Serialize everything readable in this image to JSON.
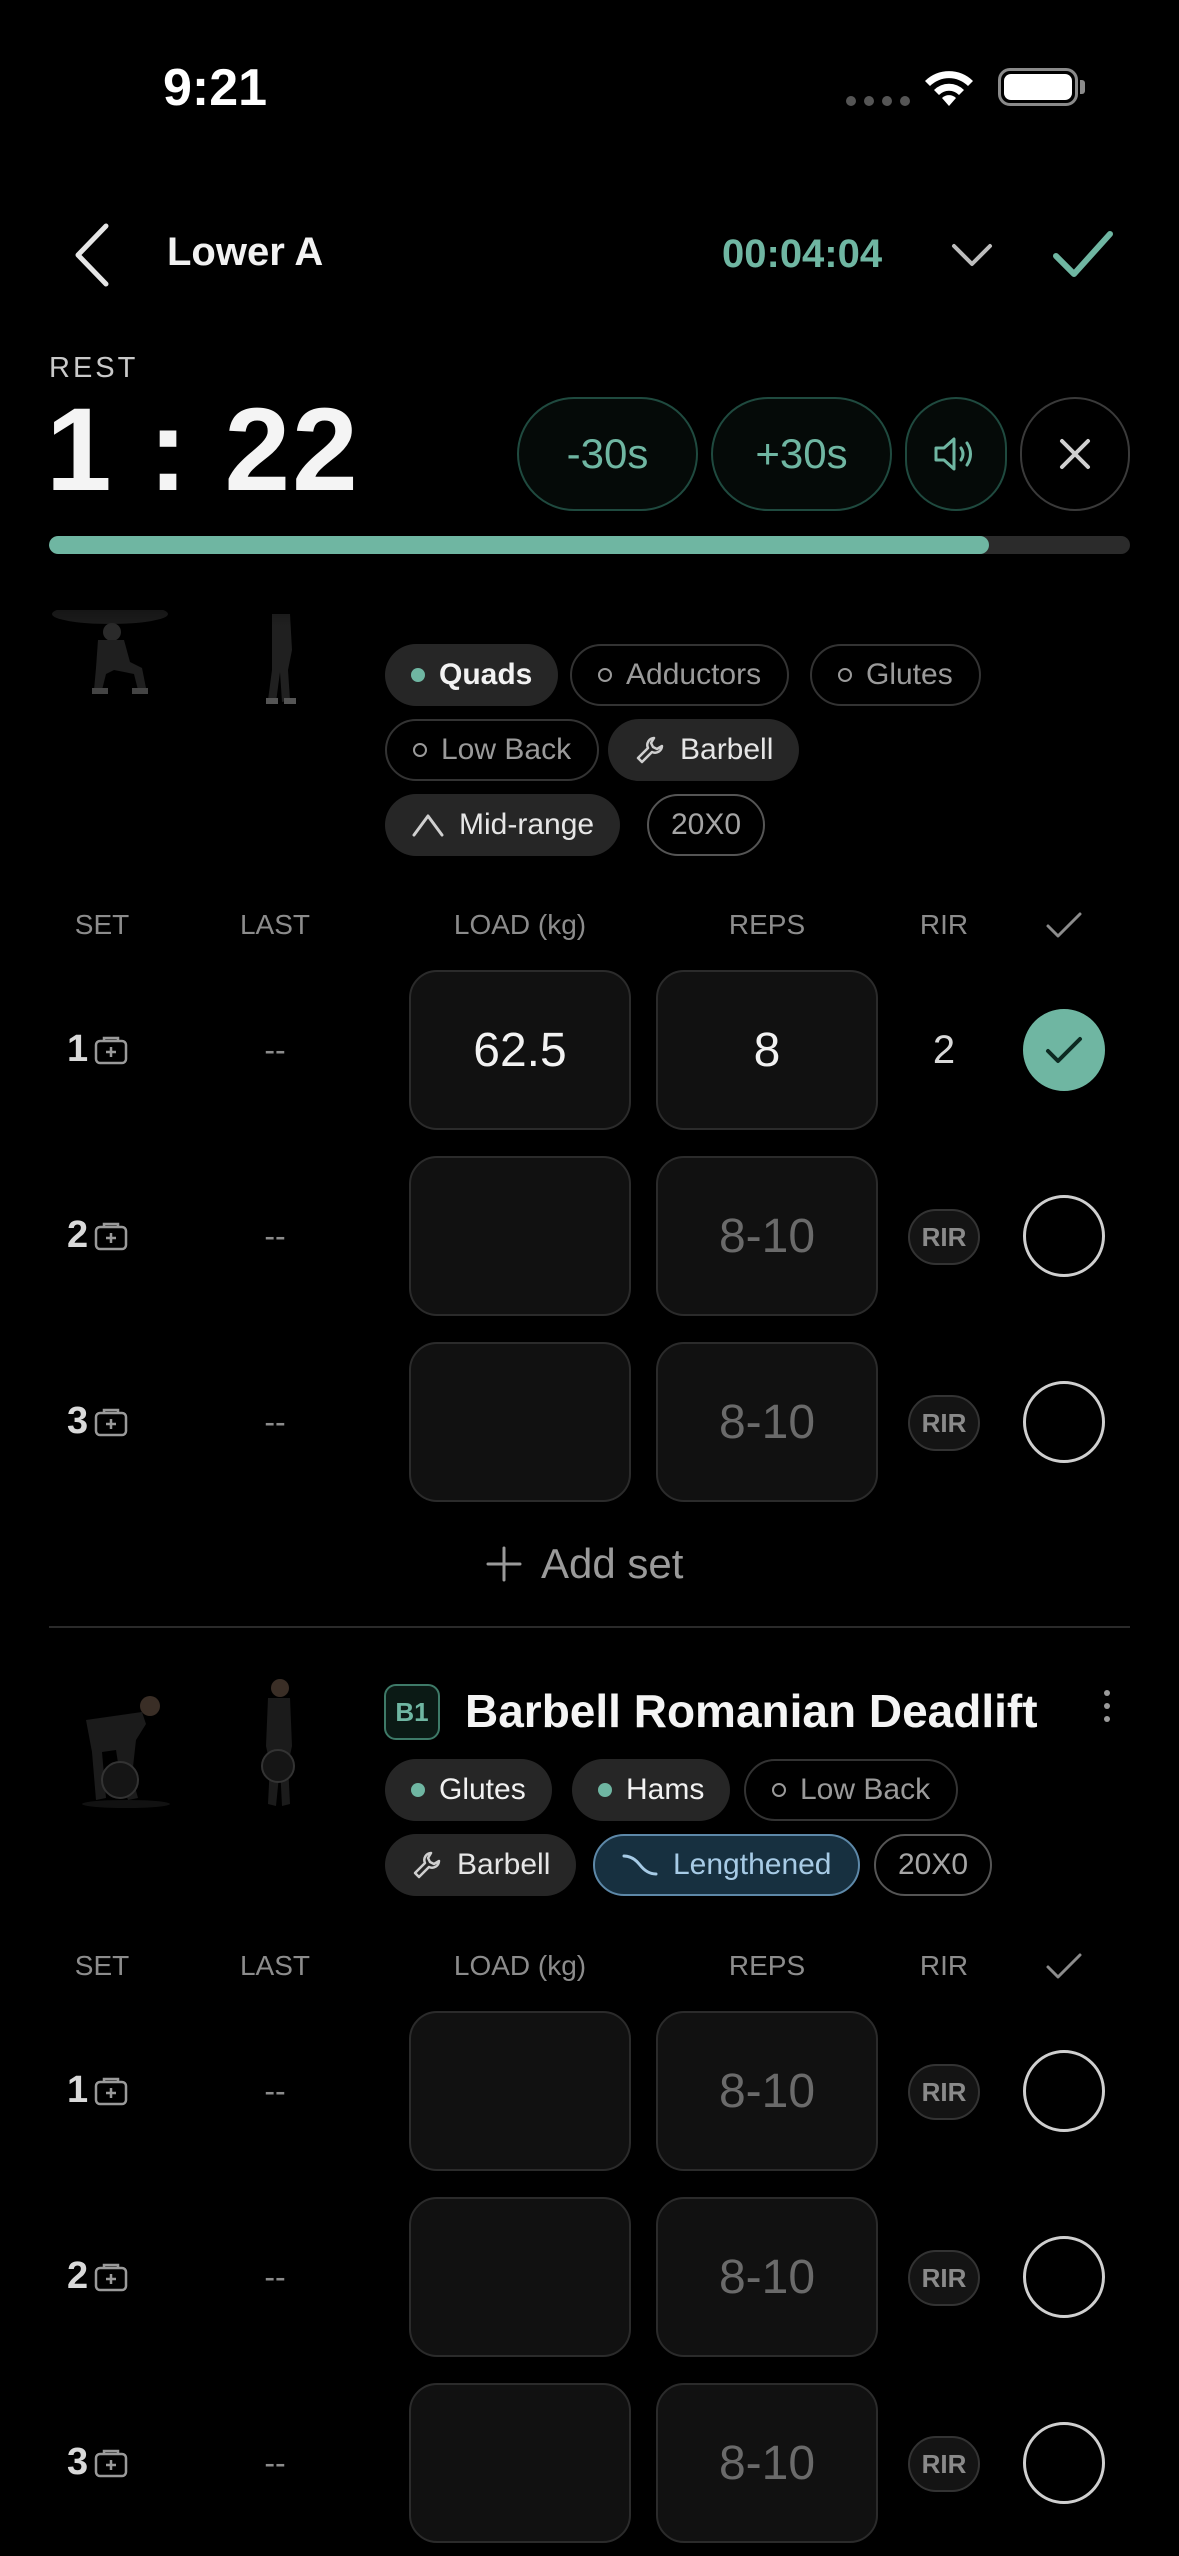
{
  "status": {
    "time": "9:21"
  },
  "header": {
    "title": "Lower A",
    "elapsed": "00:04:04"
  },
  "rest": {
    "label": "REST",
    "time": "1 : 22",
    "minus_label": "-30s",
    "plus_label": "+30s",
    "progress": 0.87
  },
  "exercise1": {
    "chips": {
      "quads": "Quads",
      "adductors": "Adductors",
      "glutes": "Glutes",
      "low_back": "Low Back",
      "equipment": "Barbell",
      "range": "Mid-range",
      "tempo": "20X0"
    },
    "headers": {
      "set": "SET",
      "last": "LAST",
      "load": "LOAD (kg)",
      "reps": "REPS",
      "rir": "RIR"
    },
    "sets": [
      {
        "num": "1",
        "last": "--",
        "load": "62.5",
        "reps": "8",
        "rir": "2"
      },
      {
        "num": "2",
        "last": "--",
        "reps_placeholder": "8-10",
        "rir_placeholder": "RIR"
      },
      {
        "num": "3",
        "last": "--",
        "reps_placeholder": "8-10",
        "rir_placeholder": "RIR"
      }
    ],
    "add_set": "Add set"
  },
  "exercise2": {
    "badge": "B1",
    "title": "Barbell Romanian Deadlift",
    "chips": {
      "glutes": "Glutes",
      "hams": "Hams",
      "low_back": "Low Back",
      "equipment": "Barbell",
      "range": "Lengthened",
      "tempo": "20X0"
    },
    "headers": {
      "set": "SET",
      "last": "LAST",
      "load": "LOAD (kg)",
      "reps": "REPS",
      "rir": "RIR"
    },
    "sets": [
      {
        "num": "1",
        "last": "--",
        "reps_placeholder": "8-10",
        "rir_placeholder": "RIR"
      },
      {
        "num": "2",
        "last": "--",
        "reps_placeholder": "8-10",
        "rir_placeholder": "RIR"
      },
      {
        "num": "3",
        "last": "--",
        "reps_placeholder": "8-10",
        "rir_placeholder": "RIR"
      }
    ]
  },
  "colors": {
    "accent": "#6fb6a2",
    "lengthened": "#a7cbe6"
  }
}
